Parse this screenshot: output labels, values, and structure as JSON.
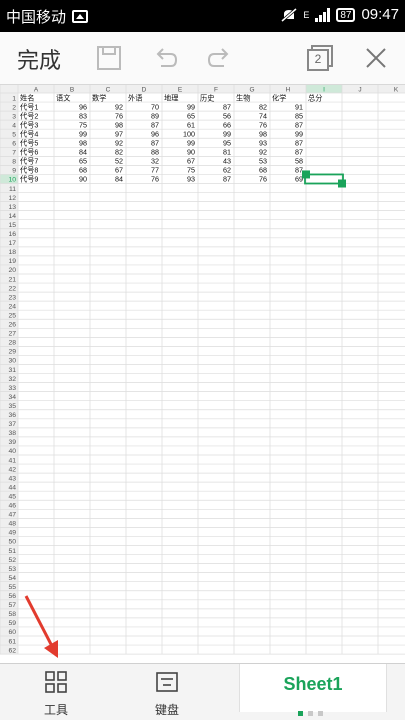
{
  "status_bar": {
    "carrier": "中国移动",
    "signal_label": "E",
    "battery": "87",
    "time": "09:47"
  },
  "toolbar": {
    "done_label": "完成",
    "page_count": "2"
  },
  "sheet": {
    "column_letters": [
      "A",
      "B",
      "C",
      "D",
      "E",
      "F",
      "G",
      "H",
      "I",
      "J",
      "K"
    ],
    "header_row": [
      "姓名",
      "语文",
      "数学",
      "外语",
      "地理",
      "历史",
      "生物",
      "化学",
      "总分"
    ],
    "rows": [
      [
        "代号1",
        "96",
        "92",
        "70",
        "99",
        "87",
        "82",
        "91"
      ],
      [
        "代号2",
        "83",
        "76",
        "89",
        "65",
        "56",
        "74",
        "85"
      ],
      [
        "代号3",
        "75",
        "98",
        "87",
        "61",
        "66",
        "76",
        "87"
      ],
      [
        "代号4",
        "99",
        "97",
        "96",
        "100",
        "99",
        "98",
        "99"
      ],
      [
        "代号5",
        "98",
        "92",
        "87",
        "99",
        "95",
        "93",
        "87"
      ],
      [
        "代号6",
        "84",
        "82",
        "88",
        "90",
        "81",
        "92",
        "87"
      ],
      [
        "代号7",
        "65",
        "52",
        "32",
        "67",
        "43",
        "53",
        "58"
      ],
      [
        "代号8",
        "68",
        "67",
        "77",
        "75",
        "62",
        "68",
        "87"
      ],
      [
        "代号9",
        "90",
        "84",
        "76",
        "93",
        "87",
        "76",
        "69"
      ]
    ],
    "row_count": 62,
    "selected_cell": "I10",
    "accent": "#1aa35a"
  },
  "bottom_bar": {
    "tools_label": "工具",
    "keyboard_label": "键盘",
    "sheet_tab_label": "Sheet1"
  }
}
